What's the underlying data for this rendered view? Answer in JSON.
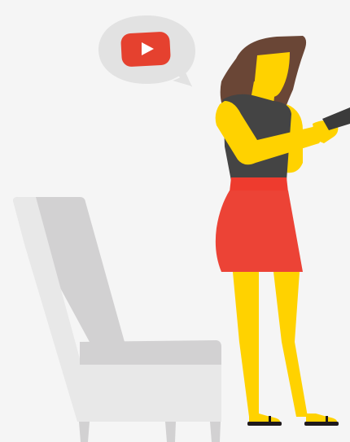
{
  "illustration": {
    "icons": {
      "speech_bubble": "speech-bubble-icon",
      "video_play": "youtube-play-icon",
      "phone": "smartphone-icon"
    },
    "colors": {
      "background": "#f5f5f5",
      "bubble": "#e2e2e2",
      "play_button_red": "#e5412f",
      "play_triangle": "#ffffff",
      "chair_front": "#e8e8e8",
      "chair_back": "#d2d1d2",
      "chair_shadow": "#c6c6c6",
      "hair": "#6a4636",
      "skin_yellow": "#ffd200",
      "skin_yellow_dark": "#e8b800",
      "top": "#444444",
      "belt": "#ee3b2e",
      "skirt": "#ec4336",
      "shoe": "#1f1a1c",
      "phone": "#3b3b3b"
    }
  }
}
